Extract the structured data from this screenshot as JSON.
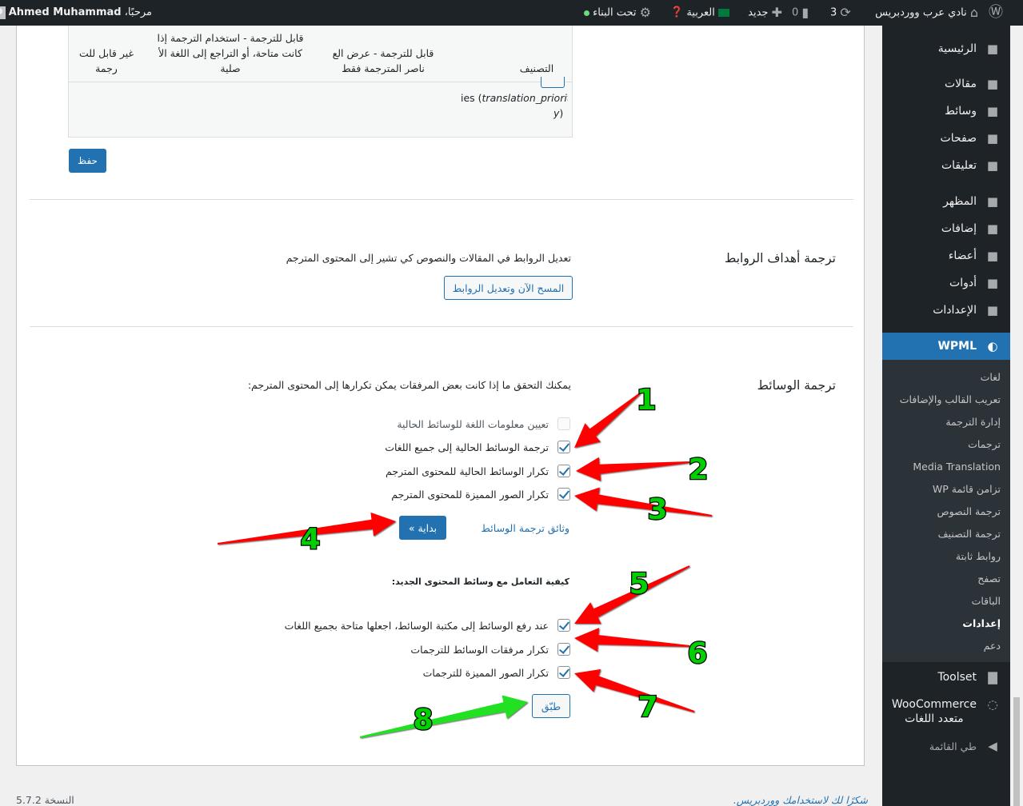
{
  "adminbar": {
    "site_name": "نادي عرب ووردبريس",
    "updates": "3",
    "comments": "0",
    "new_label": "جديد",
    "language": "العربية",
    "maintenance": "تحت البناء",
    "greeting": "مرحبًا،",
    "user_name": "Ahmed Muhammad"
  },
  "sidebar": {
    "items": [
      {
        "label": "الرئيسية",
        "icon": "dashboard-icon"
      },
      {
        "label": "مقالات",
        "icon": "pin-icon"
      },
      {
        "label": "وسائط",
        "icon": "media-icon"
      },
      {
        "label": "صفحات",
        "icon": "pages-icon"
      },
      {
        "label": "تعليقات",
        "icon": "comments-icon"
      },
      {
        "label": "المظهر",
        "icon": "appearance-icon"
      },
      {
        "label": "إضافات",
        "icon": "plugins-icon"
      },
      {
        "label": "أعضاء",
        "icon": "users-icon"
      },
      {
        "label": "أدوات",
        "icon": "tools-icon"
      },
      {
        "label": "الإعدادات",
        "icon": "settings-icon"
      }
    ],
    "wpml": {
      "label": "WPML",
      "icon": "wpml-icon"
    },
    "submenu": [
      "لغات",
      "تعريب القالب والإضافات",
      "إدارة الترجمة",
      "ترجمات",
      "Media Translation",
      "تزامن قائمة WP",
      "ترجمة النصوص",
      "ترجمة التصنيف",
      "روابط ثابتة",
      "تصفح",
      "الباقات",
      "إعدادات",
      "دعم"
    ],
    "active_sub": "إعدادات",
    "toolset": {
      "label": "Toolset",
      "icon": "toolset-icon"
    },
    "woocommerce": {
      "line1": "WooCommerce",
      "line2": "متعدد اللغات",
      "icon": "woocommerce-icon"
    },
    "collapse": {
      "label": "طي القائمة",
      "icon": "collapse-icon"
    }
  },
  "table": {
    "headers": [
      "التصنيف",
      "قابل للترجمة - عرض العناصر المترجمة فقط",
      "قابل للترجمة - استخدام الترجمة إذا كانت متاحة، أو التراجع إلى اللغة الأصلية",
      "غير قابل للترجمة"
    ],
    "row_text_prefix": "ies (",
    "row_text_italic": "translation_priority",
    "row_text_suffix": ")"
  },
  "save_button": "حفظ",
  "link_targets": {
    "title": "ترجمة أهداف الروابط",
    "description": "تعديل الروابط في المقالات والنصوص كي تشير إلى المحتوى المترجم",
    "button": "المسح الآن وتعديل الروابط"
  },
  "media": {
    "title": "ترجمة الوسائط",
    "description": "يمكنك التحقق ما إذا كانت بعض المرفقات يمكن تكرارها إلى المحتوى المترجم:",
    "existing_options": [
      {
        "label": "تعيين معلومات اللغة للوسائط الحالية",
        "checked": false
      },
      {
        "label": "ترجمة الوسائط الحالية إلى جميع اللغات",
        "checked": true
      },
      {
        "label": "تكرار الوسائط الحالية للمحتوى المترجم",
        "checked": true
      },
      {
        "label": "تكرار الصور المميزة للمحتوى المترجم",
        "checked": true
      }
    ],
    "start_button": "بداية »",
    "docs_link": "وثائق ترجمة الوسائط",
    "new_content_heading": "كيفية التعامل مع وسائط المحتوى الجديد:",
    "new_options": [
      {
        "label": "عند رفع الوسائط إلى مكتبة الوسائط، اجعلها متاحة بجميع اللغات",
        "checked": true
      },
      {
        "label": "تكرار مرفقات الوسائط للترجمات",
        "checked": true
      },
      {
        "label": "تكرار الصور المميزة للترجمات",
        "checked": true
      }
    ],
    "apply_button": "طبّق"
  },
  "footer": {
    "thanks": "شكرًا لك لاستخدامك ووردبريس.",
    "version": "النسخة 5.7.2"
  },
  "annotations": {
    "labels": [
      "1",
      "2",
      "3",
      "4",
      "5",
      "6",
      "7",
      "8"
    ],
    "arrow_color": "#ff0000",
    "highlight_arrow_color": "#22e022",
    "label_color": "#00d000"
  }
}
